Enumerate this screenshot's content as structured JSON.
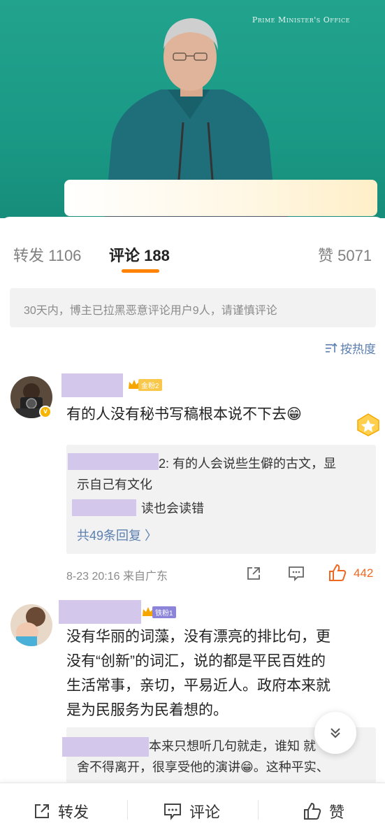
{
  "video": {
    "watermark": "Prime Minister's Office"
  },
  "tabs": [
    {
      "label": "转发 1106"
    },
    {
      "label": "评论 188"
    },
    {
      "label": "赞 5071"
    }
  ],
  "notice": "30天内，博主已拉黑恶意评论用户9人，请谨慎评论",
  "sort_label": "按热度",
  "comments": [
    {
      "fan_badge": "金粉2",
      "text": "有的人没有秘书写稿根本说不下去😁",
      "replies": [
        {
          "text": "2: 有的人会说些生僻的古文，显"
        },
        {
          "text": "示自己有文化"
        },
        {
          "text": "读也会读错"
        }
      ],
      "more_replies": "共49条回复 〉",
      "time_source": "8-23 20:16  来自广东",
      "likes": "442"
    },
    {
      "fan_badge": "铁粉1",
      "lines": [
        "没有华丽的词藻，没有漂亮的排比句，更",
        "没有“创新”的词汇，说的都是平民百姓的",
        "生活常事，亲切，平易近人。政府本来就",
        "是为民服务为民着想的。"
      ],
      "replies": [
        {
          "text": "本来只想听几句就走，谁知   就"
        },
        {
          "text": "舍不得离开，很享受他的演讲😁。这种平实、"
        }
      ]
    }
  ],
  "bottom_bar": {
    "repost": "转发",
    "comment": "评论",
    "like": "赞"
  },
  "colors": {
    "accent": "#ff8200",
    "link": "#5b7fb0",
    "like": "#ef6820",
    "video_bg": "#1fa08b",
    "name_mask": "#d4c7ec"
  }
}
